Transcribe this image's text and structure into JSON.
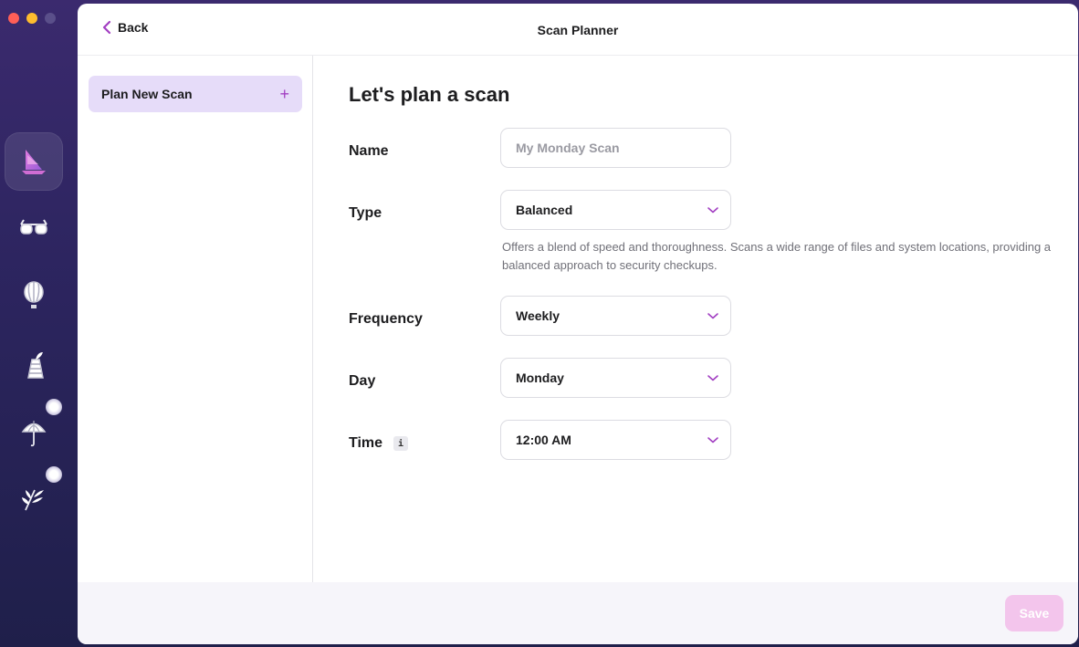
{
  "window": {
    "title": "Scan Planner",
    "back_label": "Back"
  },
  "rail": {
    "items": [
      {
        "icon": "boat-icon",
        "active": true
      },
      {
        "icon": "glasses-icon",
        "active": false
      },
      {
        "icon": "balloon-icon",
        "active": false
      },
      {
        "icon": "tower-icon",
        "active": false
      },
      {
        "icon": "umbrella-icon",
        "active": false
      },
      {
        "icon": "leaves-icon",
        "active": false
      }
    ]
  },
  "sidebar": {
    "plan_new_scan": "Plan New Scan",
    "plan_new_scan_plus": "+"
  },
  "form": {
    "heading": "Let's plan a scan",
    "name_label": "Name",
    "name_placeholder": "My Monday Scan",
    "name_value": "",
    "type_label": "Type",
    "type_value": "Balanced",
    "type_description": "Offers a blend of speed and thoroughness. Scans a wide range of files and system locations, providing a balanced approach to security checkups.",
    "frequency_label": "Frequency",
    "frequency_value": "Weekly",
    "day_label": "Day",
    "day_value": "Monday",
    "time_label": "Time",
    "time_info": "i",
    "time_value": "12:00 AM"
  },
  "footer": {
    "save_label": "Save"
  },
  "colors": {
    "accent": "#a23fc2",
    "sidebar_selected": "#e6dcf9",
    "save_disabled": "#f3c5ec"
  }
}
